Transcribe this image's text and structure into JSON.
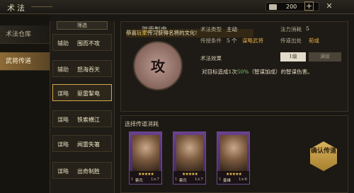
{
  "window": {
    "title": "术法",
    "currency_value": "200",
    "add_label": "+",
    "close_label": "✕"
  },
  "nav": {
    "items": [
      {
        "label": "术法仓库"
      },
      {
        "label": "武将传道"
      }
    ]
  },
  "list": {
    "filter_label": "筛选",
    "items": [
      {
        "type": "辅助",
        "name": "围而不攻"
      },
      {
        "type": "辅助",
        "name": "怒海吞天"
      },
      {
        "type": "谋略",
        "name": "驱雷掣电"
      },
      {
        "type": "谋略",
        "name": "铁索横江"
      },
      {
        "type": "谋略",
        "name": "闻雷失箸"
      },
      {
        "type": "谋略",
        "name": "出奇制胜"
      }
    ]
  },
  "detail": {
    "skill_title": "驱雷掣电",
    "skill_glyph": "攻",
    "notice_prefix": "恭喜",
    "notice_highlight": "玩家",
    "notice_suffix": "传习获得名将的文化!",
    "skill_type_label": "术法类型",
    "skill_type_value": "主动",
    "skill_cost_label": "法力消耗",
    "skill_cost_value": "5",
    "suits_label": "传授条件",
    "suits_value": "5 个",
    "suits_link": "谋略武将",
    "transfer_label": "传道出处",
    "transfer_value": "荀彧",
    "effect_label": "术法效果",
    "level_tab1": "1级",
    "level_tab2": "满级",
    "effect_desc_prefix": "对目标造成1次",
    "effect_desc_pct": "50%",
    "effect_desc_suffix": "（智谋加成）的智谋伤害。"
  },
  "consume": {
    "title": "选择传道消耗",
    "cards": [
      {
        "name": "蔡氏",
        "level": "Lv.7",
        "cost": "1"
      },
      {
        "name": "蔡氏",
        "level": "Lv.7",
        "cost": "1"
      },
      {
        "name": "姜维",
        "level": "Lv.6",
        "cost": "1"
      }
    ],
    "confirm_label": "确认传道"
  },
  "colors": {
    "accent": "#d6a84a",
    "purple_card": "#6a3f8e",
    "confirm": "#d9b15c"
  }
}
